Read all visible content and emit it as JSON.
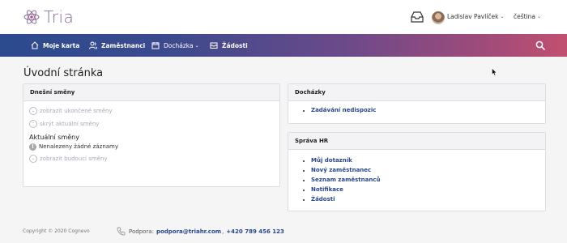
{
  "header": {
    "logo_text": "Tria",
    "user_name": "Ladislav Pavlíček",
    "language": "čeština"
  },
  "nav": {
    "items": [
      {
        "label": "Moje karta",
        "icon": "home-icon"
      },
      {
        "label": "Zaměstnanci",
        "icon": "people-icon"
      },
      {
        "label": "Docházka",
        "icon": "calendar-icon",
        "dropdown": true
      },
      {
        "label": "Žádosti",
        "icon": "mail-icon"
      }
    ]
  },
  "page": {
    "title": "Úvodní stránka"
  },
  "shifts_card": {
    "title": "Dnešní směny",
    "show_finished": "zobrazit ukončené směny",
    "hide_current": "skrýt aktuální směny",
    "current_label": "Aktuální směny",
    "no_records": "Nenalezeny žádné záznamy",
    "show_future": "zobrazit budoucí směny"
  },
  "attendance_card": {
    "title": "Docházky",
    "links": [
      "Zadávání nedispozic"
    ]
  },
  "hr_card": {
    "title": "Správa HR",
    "links": [
      "Můj dotazník",
      "Nový zaměstnanec",
      "Seznam zaměstnanců",
      "Notifikace",
      "Žádosti"
    ]
  },
  "footer": {
    "copyright": "Copyright © 2020 Cognevo",
    "support_label": "Podpora:",
    "support_email": "podpora@triahr.com",
    "separator": ",",
    "support_phone": "+420 789 456 123"
  },
  "colors": {
    "nav_gradient_start": "#2c4a8e",
    "nav_gradient_end": "#c1506f",
    "link": "#27468c",
    "muted_link": "#a5aab8"
  }
}
